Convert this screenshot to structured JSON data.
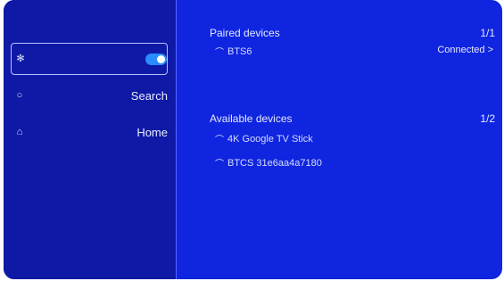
{
  "sidebar": {
    "items": [
      {
        "icon": "bluetooth-icon",
        "label": "",
        "toggle_on": true
      },
      {
        "icon": "search-icon",
        "label": "Search"
      },
      {
        "icon": "home-icon",
        "label": "Home"
      }
    ]
  },
  "paired": {
    "title": "Paired devices",
    "count": "1/1",
    "devices": [
      {
        "name": "BTS6",
        "status": "Connected >"
      }
    ]
  },
  "available": {
    "title": "Available devices",
    "count": "1/2",
    "devices": [
      {
        "name": "4K Google TV Stick"
      },
      {
        "name": "BTCS 31e6aa4a7180"
      }
    ]
  },
  "colors": {
    "screen_bg": "#0f25e0",
    "sidebar_bg": "#0e1aa6",
    "toggle_on": "#2a8cff"
  }
}
